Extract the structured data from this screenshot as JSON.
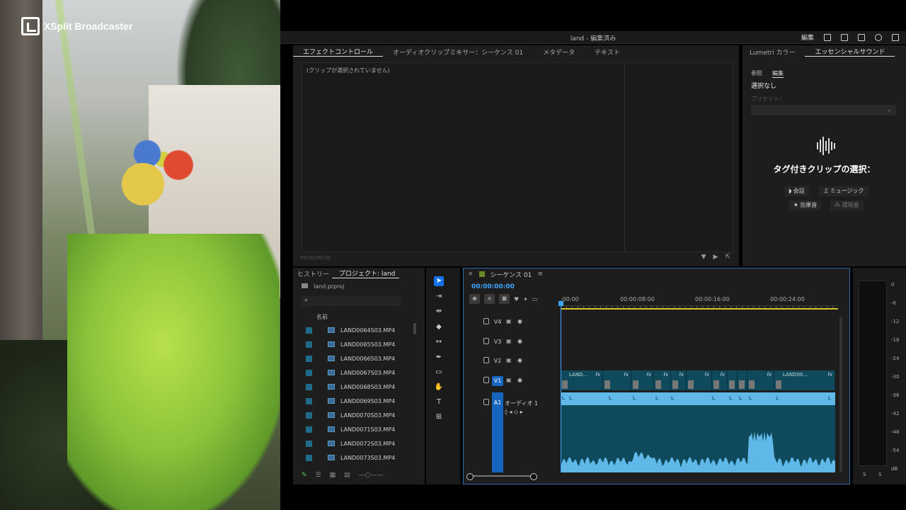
{
  "overlay": {
    "brand": "XSplit Broadcaster"
  },
  "titlebar": {
    "title": "land - 編集済み",
    "edit_label": "編集"
  },
  "effect_panel": {
    "tabs": [
      "エフェクトコントロール",
      "オーディオクリップミキサー：シーケンス 01",
      "メタデータ",
      "テキスト"
    ],
    "no_clip": "(クリップが選択されていません)",
    "timecode": "00;00;00;00"
  },
  "essential_sound": {
    "tabs": [
      "Lumetri カラー",
      "エッセンシャルサウンド"
    ],
    "subtabs": [
      "参照",
      "編集"
    ],
    "no_selection": "選択なし",
    "preset_label": "プリセット：",
    "heading": "タグ付きクリップの選択：",
    "types": [
      "会話",
      "ミュージック",
      "効果音",
      "環境音"
    ]
  },
  "project": {
    "tabs": [
      "ヒストリー",
      "プロジェクト: land"
    ],
    "file": "land.prproj",
    "column_name": "名前",
    "items": [
      "LAND0064S03.MP4",
      "LAND0065S03.MP4",
      "LAND0066S03.MP4",
      "LAND0067S03.MP4",
      "LAND0068S03.MP4",
      "LAND0069S03.MP4",
      "LAND0070S03.MP4",
      "LAND0071S03.MP4",
      "LAND0072S03.MP4",
      "LAND0073S03.MP4"
    ]
  },
  "sequence": {
    "tab": "シーケンス 01",
    "timecode": "00:00:00:00",
    "ruler": [
      ":00:00",
      "00:00:08:00",
      "00:00:16:00",
      "00:00:24:00"
    ],
    "tracks": [
      "V4",
      "V3",
      "V2",
      "V1"
    ],
    "audio_track": "A1",
    "audio_label": "オーディオ 1",
    "clip_labels": [
      "LAND...",
      "LAND00..."
    ],
    "fx": "fx"
  },
  "meter": {
    "scale": [
      "0",
      "-6",
      "-12",
      "-18",
      "-24",
      "-30",
      "-36",
      "-42",
      "-48",
      "-54",
      "dB"
    ],
    "channels": [
      "S",
      "S"
    ]
  },
  "colors": {
    "accent": "#1473e6",
    "timecode": "#3fa6ff",
    "clip_video": "#0e4a5c",
    "clip_audio": "#5fb8e8"
  }
}
